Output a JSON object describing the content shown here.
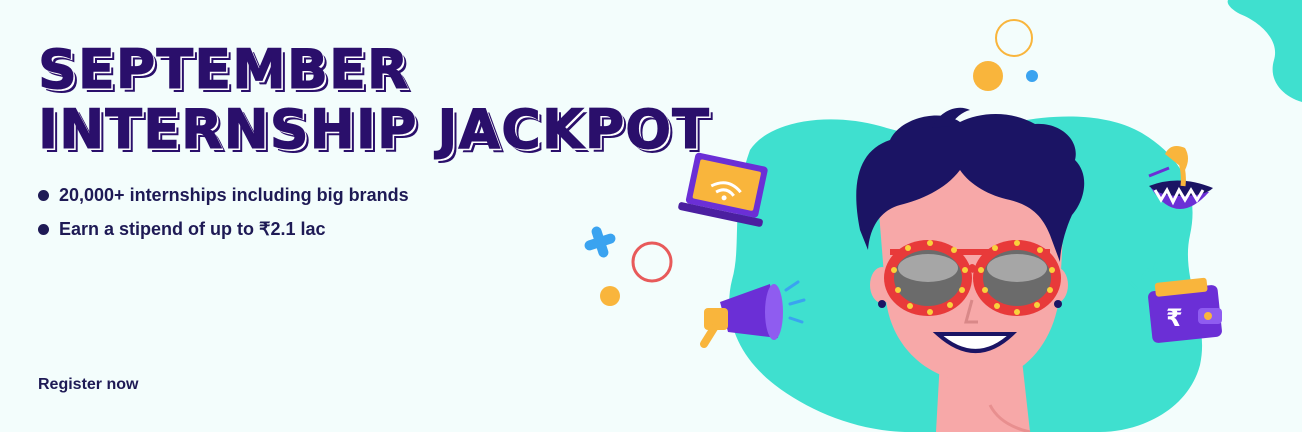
{
  "banner": {
    "title_line1": "SEPTEMBER",
    "title_line2": "INTERNSHIP JACKPOT",
    "bullets": [
      "20,000+ internships including big brands",
      "Earn a stipend of up to ₹2.1 lac"
    ],
    "cta_label": "Register now",
    "wallet_symbol": "₹"
  },
  "colors": {
    "background": "#f3fdfc",
    "headline": "#2a0f6b",
    "text": "#1e1a55",
    "teal_blob": "#3fe0cf",
    "skin": "#f7a8a8",
    "hair": "#1b1464",
    "glasses_frame": "#e83a3a",
    "accent_yellow": "#f9b53c",
    "accent_blue": "#3aa3f0",
    "purple": "#6b2fd6"
  },
  "icons": [
    "laptop-wifi-icon",
    "megaphone-icon",
    "coconut-drink-icon",
    "wallet-rupee-icon",
    "cross-icon",
    "circle-icon"
  ]
}
